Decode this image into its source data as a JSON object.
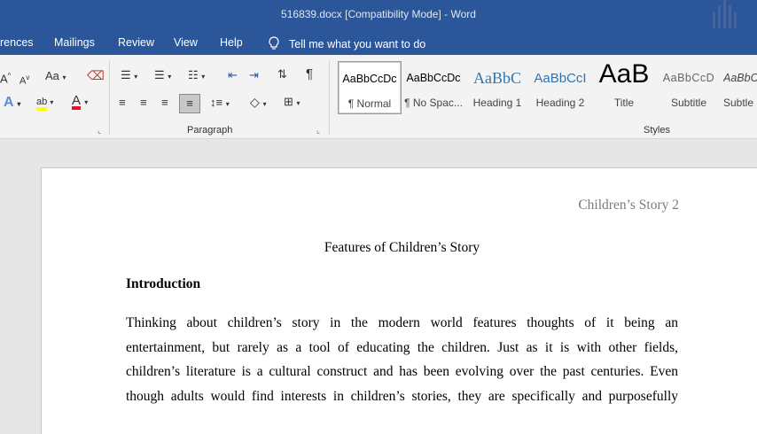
{
  "window": {
    "title": "516839.docx [Compatibility Mode]  -  Word"
  },
  "menu": {
    "items": [
      "rences",
      "Mailings",
      "Review",
      "View",
      "Help"
    ],
    "tell_me": "Tell me what you want to do"
  },
  "ribbon": {
    "groups": {
      "paragraph": "Paragraph",
      "styles": "Styles"
    },
    "font_buttons": {
      "grow": "A",
      "shrink": "A",
      "change_case": "Aa",
      "text_effects": "A",
      "highlight": "ab",
      "font_color": "A"
    },
    "styles": [
      {
        "sample": "AaBbCcDc",
        "name": "¶ Normal",
        "selected": true
      },
      {
        "sample": "AaBbCcDc",
        "name": "¶ No Spac..."
      },
      {
        "sample": "AaBbC",
        "name": "Heading 1"
      },
      {
        "sample": "AaBbCcI",
        "name": "Heading 2"
      },
      {
        "sample": "AaB",
        "name": "Title"
      },
      {
        "sample": "AaBbCcD",
        "name": "Subtitle"
      },
      {
        "sample": "AaBbC",
        "name": "Subtle"
      }
    ],
    "colors": {
      "highlight": "#ffff00",
      "font": "#e81123",
      "accent": "#2b579a"
    }
  },
  "document": {
    "header": "Children’s Story 2",
    "title": "Features of Children’s Story",
    "heading": "Introduction",
    "paragraph_lines": [
      "Thinking about children’s story in the modern world features thoughts of it being an",
      "entertainment, but rarely as a tool of educating the children. Just as it is with other fields,",
      "children’s literature is a cultural construct and has been evolving over the past centuries. Even",
      "though adults would find interests in children’s stories, they are specifically and purposefully"
    ]
  }
}
